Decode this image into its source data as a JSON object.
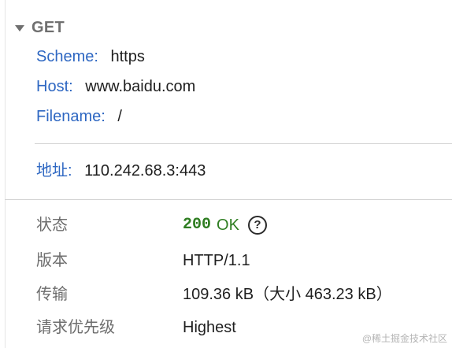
{
  "request": {
    "method": "GET"
  },
  "url": {
    "scheme_label": "Scheme:",
    "scheme_value": "https",
    "host_label": "Host:",
    "host_value": "www.baidu.com",
    "filename_label": "Filename:",
    "filename_value": "/",
    "address_label": "地址:",
    "address_value": "110.242.68.3:443"
  },
  "info": {
    "status_label": "状态",
    "status_code": "200",
    "status_text": "OK",
    "help_glyph": "?",
    "version_label": "版本",
    "version_value": "HTTP/1.1",
    "transfer_label": "传输",
    "transfer_value": "109.36 kB（大小 463.23 kB）",
    "priority_label": "请求优先级",
    "priority_value": "Highest"
  },
  "watermark": "@稀土掘金技术社区",
  "colors": {
    "key_blue": "#2e67c2",
    "status_green": "#2e7d21",
    "label_gray": "#6d6d6d"
  },
  "icons": {
    "collapse": "triangle-down-icon",
    "help": "question-circle-icon"
  }
}
